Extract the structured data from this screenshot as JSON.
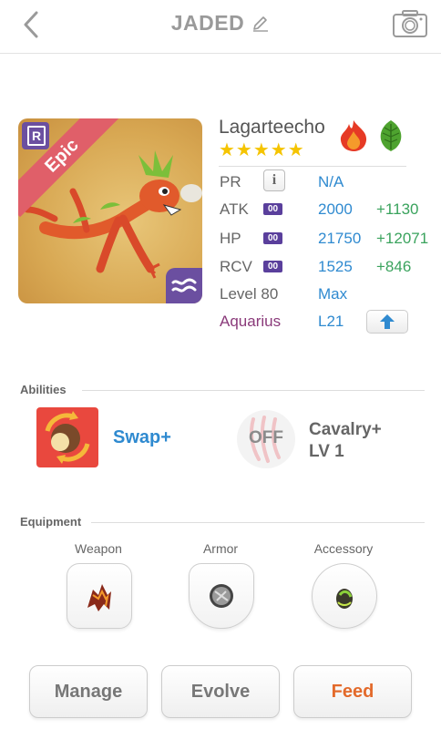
{
  "header": {
    "title": "JADED",
    "back_icon": "chevron-left-icon",
    "edit_icon": "pencil-icon",
    "camera_icon": "camera-icon"
  },
  "monster": {
    "name": "Lagarteecho",
    "rarity": "Epic",
    "rarity_badge": "R",
    "stars": "★★★★★",
    "star_count": 5,
    "elements": [
      "fire",
      "wood"
    ],
    "accent_colors": {
      "epic_ribbon": "#e05f69",
      "badge_purple": "#6b4fa0",
      "value_blue": "#2f8ad0",
      "bonus_green": "#3aa35d",
      "aquarius_purple": "#8a3a7a",
      "feed_orange": "#e36a2b"
    }
  },
  "stats": {
    "pr": {
      "label": "PR",
      "value": "N/A"
    },
    "atk": {
      "label": "ATK",
      "plus": "00",
      "value": "2000",
      "bonus": "+1130"
    },
    "hp": {
      "label": "HP",
      "plus": "00",
      "value": "21750",
      "bonus": "+12071"
    },
    "rcv": {
      "label": "RCV",
      "plus": "00",
      "value": "1525",
      "bonus": "+846"
    },
    "level": {
      "label": "Level 80",
      "value": "Max"
    },
    "sign": {
      "label": "Aquarius",
      "value": "L21"
    }
  },
  "abilities": {
    "section_title": "Abilities",
    "primary": {
      "name": "Swap+"
    },
    "secondary": {
      "state": "OFF",
      "name": "Cavalry+",
      "level": "LV 1"
    }
  },
  "equipment": {
    "section_title": "Equipment",
    "slots": [
      {
        "label": "Weapon",
        "icon": "weapon-icon"
      },
      {
        "label": "Armor",
        "icon": "armor-icon"
      },
      {
        "label": "Accessory",
        "icon": "accessory-icon"
      }
    ]
  },
  "actions": {
    "manage": "Manage",
    "evolve": "Evolve",
    "feed": "Feed"
  }
}
